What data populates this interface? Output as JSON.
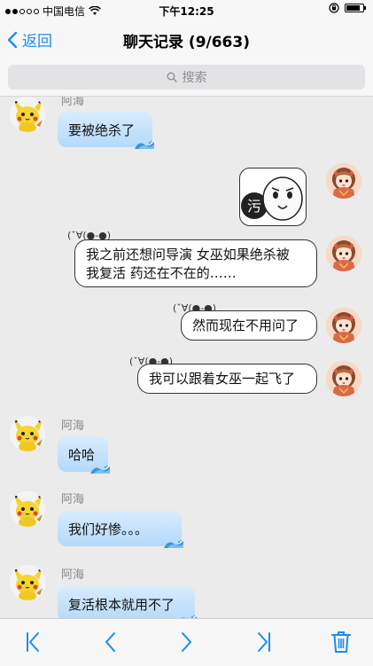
{
  "status": {
    "carrier": "中国电信",
    "time": "下午12:25",
    "battery_level": 0.85
  },
  "nav": {
    "back_label": "返回",
    "title": "聊天记录 (9/663)"
  },
  "search": {
    "placeholder": "搜索"
  },
  "messages": [
    {
      "sender": "阿海",
      "text": "要被绝杀了",
      "side": "left",
      "avatar_icon": "pikachu-avatar-icon"
    },
    {
      "side": "right",
      "sticker": "污",
      "avatar_icon": "girl-avatar-icon"
    },
    {
      "side": "right",
      "kaomoji": "(ˇ∀(●-●)",
      "lines": [
        "我之前还想问导演 女巫如果绝杀被",
        "我复活 药还在不在的……"
      ],
      "avatar_icon": "girl-avatar-icon"
    },
    {
      "side": "right",
      "kaomoji": "(ˇ∀(●-●)",
      "lines": [
        "然而现在不用问了"
      ],
      "avatar_icon": "girl-avatar-icon"
    },
    {
      "side": "right",
      "kaomoji": "(ˇ∀(●-●)",
      "lines": [
        "我可以跟着女巫一起飞了"
      ],
      "avatar_icon": "girl-avatar-icon"
    },
    {
      "sender": "阿海",
      "text": "哈哈",
      "side": "left",
      "avatar_icon": "pikachu-avatar-icon"
    },
    {
      "sender": "阿海",
      "text": "我们好惨。。。",
      "side": "left",
      "avatar_icon": "pikachu-avatar-icon"
    },
    {
      "sender": "阿海",
      "text": "复活根本就用不了",
      "side": "left",
      "avatar_icon": "pikachu-avatar-icon"
    }
  ],
  "toolbar": [
    "first-page-icon",
    "prev-page-icon",
    "next-page-icon",
    "last-page-icon",
    "trash-icon"
  ],
  "colors": {
    "accent": "#1a8cf0",
    "bubble_blue": "#c4e1fb",
    "background": "#ebebeb"
  }
}
